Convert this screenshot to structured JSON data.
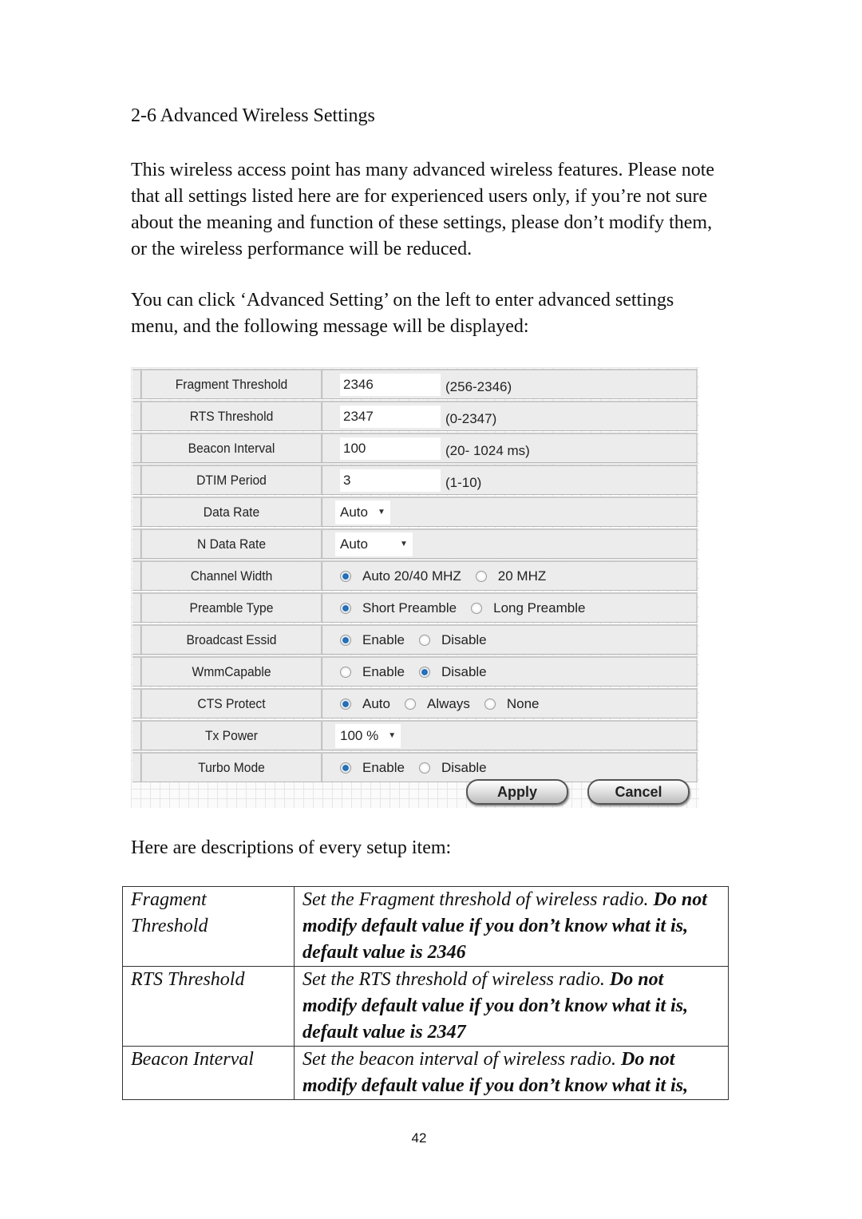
{
  "section_title": "2-6 Advanced Wireless Settings",
  "intro_paragraph": "This wireless access point has many advanced wireless features. Please note that all settings listed here are for experienced users only, if you’re not sure about the meaning and function of these settings, please don’t modify them, or the wireless performance will be reduced.",
  "instruction_paragraph": "You can click ‘Advanced Setting’ on the left to enter advanced settings menu, and the following message will be displayed:",
  "settings_form": {
    "fragment_threshold": {
      "label": "Fragment Threshold",
      "value": "2346",
      "range": "(256-2346)"
    },
    "rts_threshold": {
      "label": "RTS Threshold",
      "value": "2347",
      "range": "(0-2347)"
    },
    "beacon_interval": {
      "label": "Beacon Interval",
      "value": "100",
      "range": "(20- 1024 ms)"
    },
    "dtim_period": {
      "label": "DTIM Period",
      "value": "3",
      "range": "(1-10)"
    },
    "data_rate": {
      "label": "Data Rate",
      "selected": "Auto"
    },
    "n_data_rate": {
      "label": "N Data Rate",
      "selected": "Auto"
    },
    "channel_width": {
      "label": "Channel Width",
      "options": [
        "Auto 20/40 MHZ",
        "20 MHZ"
      ],
      "selected": "Auto 20/40 MHZ"
    },
    "preamble_type": {
      "label": "Preamble Type",
      "options": [
        "Short Preamble",
        "Long Preamble"
      ],
      "selected": "Short Preamble"
    },
    "broadcast_essid": {
      "label": "Broadcast Essid",
      "options": [
        "Enable",
        "Disable"
      ],
      "selected": "Enable"
    },
    "wmm_capable": {
      "label": "WmmCapable",
      "options": [
        "Enable",
        "Disable"
      ],
      "selected": "Disable"
    },
    "cts_protect": {
      "label": "CTS Protect",
      "options": [
        "Auto",
        "Always",
        "None"
      ],
      "selected": "Auto"
    },
    "tx_power": {
      "label": "Tx Power",
      "selected": "100 %"
    },
    "turbo_mode": {
      "label": "Turbo Mode",
      "options": [
        "Enable",
        "Disable"
      ],
      "selected": "Enable"
    },
    "apply_label": "Apply",
    "cancel_label": "Cancel"
  },
  "descriptions_intro": "Here are descriptions of every setup item:",
  "descriptions": [
    {
      "item": "Fragment Threshold",
      "text": "Set the Fragment threshold of wireless radio. ",
      "bold": "Do not modify default value if you don’t know what it is, default value is 2346"
    },
    {
      "item": "RTS Threshold",
      "text": "Set the RTS threshold of wireless radio. ",
      "bold": "Do not modify default value if you don’t know what it is, default value is 2347"
    },
    {
      "item": "Beacon Interval",
      "text": "Set the beacon interval of wireless radio. ",
      "bold": "Do not modify default value if you don’t know what it is,"
    }
  ],
  "page_number": "42"
}
